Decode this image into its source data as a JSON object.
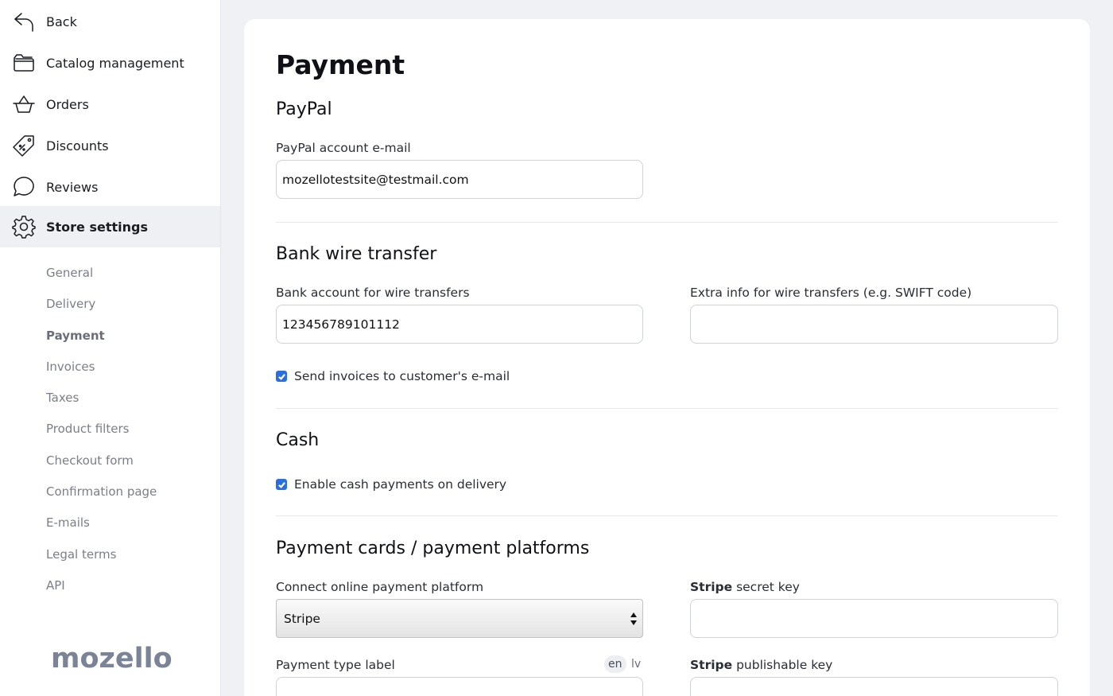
{
  "sidebar": {
    "nav": [
      {
        "label": "Back",
        "icon": "back-arrow-icon"
      },
      {
        "label": "Catalog management",
        "icon": "folder-icon"
      },
      {
        "label": "Orders",
        "icon": "basket-icon"
      },
      {
        "label": "Discounts",
        "icon": "price-tag-icon"
      },
      {
        "label": "Reviews",
        "icon": "speech-bubble-icon"
      },
      {
        "label": "Store settings",
        "icon": "gear-icon",
        "active": true
      }
    ],
    "sub": [
      "General",
      "Delivery",
      "Payment",
      "Invoices",
      "Taxes",
      "Product filters",
      "Checkout form",
      "Confirmation page",
      "E-mails",
      "Legal terms",
      "API"
    ],
    "active_sub": "Payment",
    "logo": "mozello"
  },
  "main": {
    "title": "Payment",
    "paypal": {
      "title": "PayPal",
      "email_label": "PayPal account e-mail",
      "email_value": "mozellotestsite@testmail.com"
    },
    "bank": {
      "title": "Bank wire transfer",
      "account_label": "Bank account for wire transfers",
      "account_value": "123456789101112",
      "extra_label": "Extra info for wire transfers (e.g. SWIFT code)",
      "extra_value": "",
      "send_invoices_label": "Send invoices to customer's e-mail",
      "send_invoices_checked": true
    },
    "cash": {
      "title": "Cash",
      "enable_label": "Enable cash payments on delivery",
      "enable_checked": true
    },
    "cards": {
      "title": "Payment cards / payment platforms",
      "platform_label": "Connect online payment platform",
      "platform_value": "Stripe",
      "secret_key_label_bold": "Stripe",
      "secret_key_label_rest": " secret key",
      "secret_key_value": "",
      "type_label": "Payment type label",
      "lang_en": "en",
      "lang_lv": "lv",
      "publishable_key_label_bold": "Stripe",
      "publishable_key_label_rest": " publishable key"
    }
  },
  "colors": {
    "accent": "#2a6fde",
    "active_nav_bg": "#eef0f3",
    "page_bg": "#f0f1f4"
  }
}
